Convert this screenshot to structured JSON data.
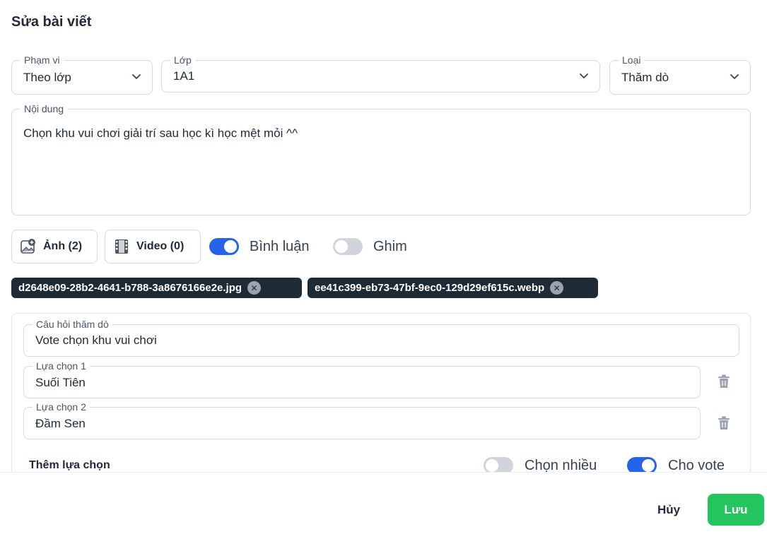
{
  "dialog": {
    "title": "Sửa bài viết"
  },
  "scope": {
    "label": "Phạm vi",
    "value": "Theo lớp"
  },
  "class": {
    "label": "Lớp",
    "value": "1A1"
  },
  "type": {
    "label": "Loại",
    "value": "Thăm dò"
  },
  "content": {
    "label": "Nội dung",
    "value": "Chọn khu vui chơi giải trí sau học kì học mệt mỏi ^^"
  },
  "toolbar": {
    "image_label": "Ảnh (2)",
    "video_label": "Video (0)",
    "comment_label": "Bình luận",
    "comment_on": true,
    "pin_label": "Ghim",
    "pin_on": false
  },
  "attachments": [
    {
      "name": "d2648e09-28b2-4641-b788-3a8676166e2e.jpg"
    },
    {
      "name": "ee41c399-eb73-47bf-9ec0-129d29ef615c.webp"
    }
  ],
  "poll": {
    "question_label": "Câu hỏi thăm dò",
    "question_value": "Vote chọn khu vui chơi",
    "options": [
      {
        "label": "Lựa chọn 1",
        "value": "Suối Tiên"
      },
      {
        "label": "Lựa chọn 2",
        "value": "Đầm Sen"
      }
    ],
    "add_option_label": "Thêm lựa chọn",
    "multi_label": "Chọn nhiều",
    "multi_on": false,
    "vote_label": "Cho vote",
    "vote_on": true
  },
  "footer": {
    "cancel_label": "Hủy",
    "save_label": "Lưu"
  },
  "colors": {
    "accent": "#2563eb",
    "save": "#22c55e",
    "chip": "#1f2a37"
  }
}
